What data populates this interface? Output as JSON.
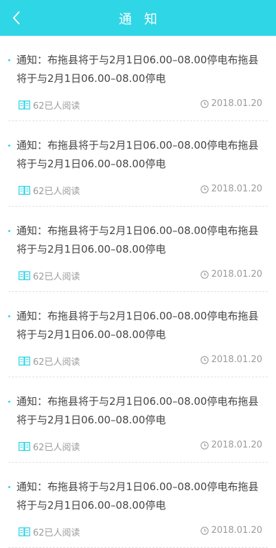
{
  "header": {
    "title": "通 知",
    "back_icon": "chevron-left-icon",
    "background": "#2fd6e6"
  },
  "notices": [
    {
      "text": "通知：布拖县将于与2月1日06.00–08.00停电布拖县将于与2月1日06.00–08.00停电",
      "reads": "62已人阅读",
      "date": "2018.01.20"
    },
    {
      "text": "通知：布拖县将于与2月1日06.00–08.00停电布拖县将于与2月1日06.00–08.00停电",
      "reads": "62已人阅读",
      "date": "2018.01.20"
    },
    {
      "text": "通知：布拖县将于与2月1日06.00–08.00停电布拖县将于与2月1日06.00–08.00停电",
      "reads": "62已人阅读",
      "date": "2018.01.20"
    },
    {
      "text": "通知：布拖县将于与2月1日06.00–08.00停电布拖县将于与2月1日06.00–08.00停电",
      "reads": "62已人阅读",
      "date": "2018.01.20"
    },
    {
      "text": "通知：布拖县将于与2月1日06.00–08.00停电布拖县将于与2月1日06.00–08.00停电",
      "reads": "62已人阅读",
      "date": "2018.01.20"
    },
    {
      "text": "通知：布拖县将于与2月1日06.00–08.00停电布拖县将于与2月1日06.00–08.00停电",
      "reads": "62已人阅读",
      "date": "2018.01.20"
    }
  ]
}
